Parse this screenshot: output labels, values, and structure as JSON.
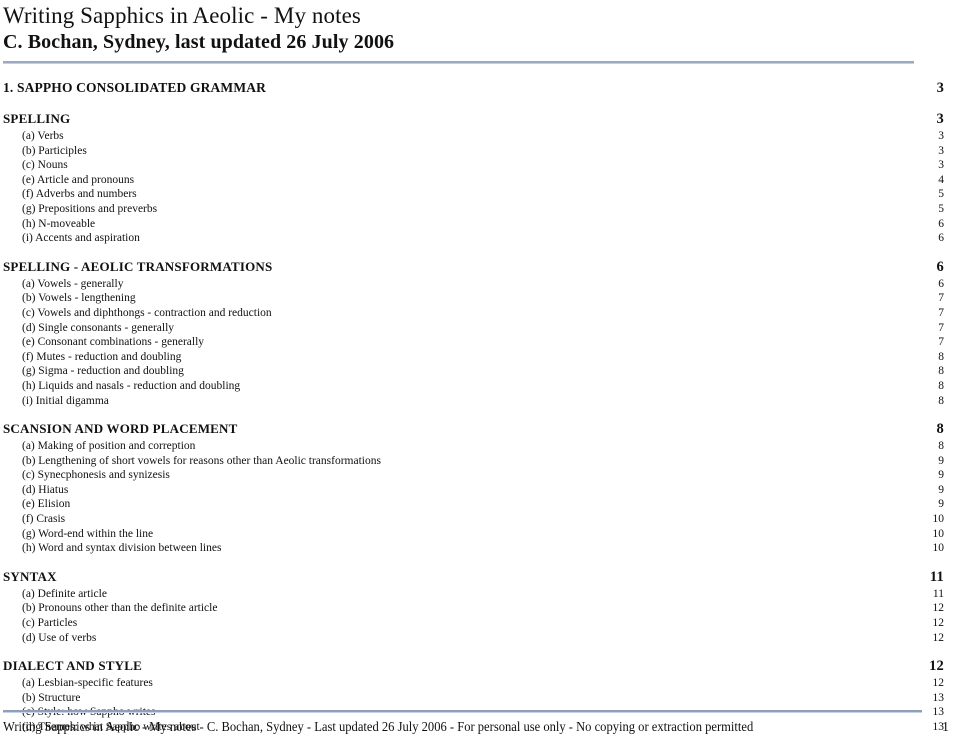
{
  "header": {
    "title": "Writing Sapphics in Aeolic - My notes",
    "subtitle": "C. Bochan, Sydney, last updated 26 July 2006"
  },
  "toc": {
    "chapter": {
      "label": "1. SAPPHO CONSOLIDATED GRAMMAR",
      "page": "3"
    },
    "sections": [
      {
        "heading": "SPELLING",
        "page": "3",
        "items": [
          {
            "label": "(a) Verbs",
            "page": "3"
          },
          {
            "label": "(b) Participles",
            "page": "3"
          },
          {
            "label": "(c) Nouns",
            "page": "3"
          },
          {
            "label": "(e) Article and pronouns",
            "page": "4"
          },
          {
            "label": "(f) Adverbs and numbers",
            "page": "5"
          },
          {
            "label": "(g) Prepositions and preverbs",
            "page": "5"
          },
          {
            "label": "(h) N-moveable",
            "page": "6"
          },
          {
            "label": "(i) Accents and aspiration",
            "page": "6"
          }
        ]
      },
      {
        "heading": "SPELLING - AEOLIC TRANSFORMATIONS",
        "page": "6",
        "items": [
          {
            "label": "(a) Vowels - generally",
            "page": "6"
          },
          {
            "label": "(b) Vowels - lengthening",
            "page": "7"
          },
          {
            "label": "(c) Vowels and diphthongs - contraction and reduction",
            "page": "7"
          },
          {
            "label": "(d) Single consonants - generally",
            "page": "7"
          },
          {
            "label": "(e) Consonant combinations - generally",
            "page": "7"
          },
          {
            "label": "(f) Mutes - reduction and doubling",
            "page": "8"
          },
          {
            "label": "(g) Sigma - reduction and doubling",
            "page": "8"
          },
          {
            "label": "(h) Liquids and nasals - reduction and doubling",
            "page": "8"
          },
          {
            "label": "(i) Initial digamma",
            "page": "8"
          }
        ]
      },
      {
        "heading": "SCANSION AND WORD PLACEMENT",
        "page": "8",
        "items": [
          {
            "label": "(a) Making of position and correption",
            "page": "8"
          },
          {
            "label": "(b) Lengthening of short vowels for reasons other than Aeolic transformations",
            "page": "9"
          },
          {
            "label": "(c) Synecphonesis and synizesis",
            "page": "9"
          },
          {
            "label": "(d) Hiatus",
            "page": "9"
          },
          {
            "label": "(e) Elision",
            "page": "9"
          },
          {
            "label": "(f) Crasis",
            "page": "10"
          },
          {
            "label": "(g) Word-end within the line",
            "page": "10"
          },
          {
            "label": "(h) Word and syntax division between lines",
            "page": "10"
          }
        ]
      },
      {
        "heading": "SYNTAX",
        "page": "11",
        "items": [
          {
            "label": "(a) Definite article",
            "page": "11"
          },
          {
            "label": "(b) Pronouns other than the definite article",
            "page": "12"
          },
          {
            "label": "(c) Particles",
            "page": "12"
          },
          {
            "label": "(d) Use of verbs",
            "page": "12"
          }
        ]
      },
      {
        "heading": "DIALECT AND STYLE",
        "page": "12",
        "items": [
          {
            "label": "(a) Lesbian-specific features",
            "page": "12"
          },
          {
            "label": "(b) Structure",
            "page": "13"
          },
          {
            "label": "(c) Style: how Sappho writes",
            "page": "13"
          },
          {
            "label": "(d) Themes: what Sappho writes about",
            "page": "13"
          }
        ]
      }
    ]
  },
  "footer": {
    "text": "Writing Sapphics in Aeolic - My notes - C. Bochan, Sydney - Last updated 26 July 2006 - For personal use only - No copying or extraction permitted",
    "page": "1"
  }
}
